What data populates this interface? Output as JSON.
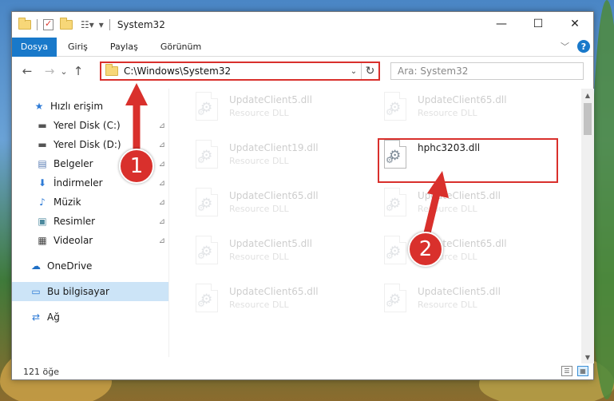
{
  "window": {
    "title": "System32",
    "qa_label": "|",
    "min": "—",
    "max": "☐",
    "close": "✕"
  },
  "ribbon": {
    "tabs": [
      "Dosya",
      "Giriş",
      "Paylaş",
      "Görünüm"
    ],
    "collapse_icon": "﹀",
    "help_label": "?"
  },
  "nav": {
    "back": "←",
    "forward": "→",
    "recent": "⌄",
    "up": "↑",
    "address": "C:\\Windows\\System32",
    "address_dropdown": "⌄",
    "refresh": "↻",
    "search_placeholder": "Ara: System32"
  },
  "sidebar": {
    "items": [
      {
        "label": "Hızlı erişim",
        "icon": "star-icon",
        "glyph": "★",
        "color": "#2e7bd6"
      },
      {
        "label": "Yerel Disk (C:)",
        "icon": "drive-icon",
        "glyph": "▬",
        "color": "#555555"
      },
      {
        "label": "Yerel Disk (D:)",
        "icon": "drive-icon",
        "glyph": "▬",
        "color": "#555555"
      },
      {
        "label": "Belgeler",
        "icon": "documents-icon",
        "glyph": "▤",
        "color": "#5d7fb5"
      },
      {
        "label": "İndirmeler",
        "icon": "download-icon",
        "glyph": "⬇",
        "color": "#2e7bd6"
      },
      {
        "label": "Müzik",
        "icon": "music-icon",
        "glyph": "♪",
        "color": "#2e7bd6"
      },
      {
        "label": "Resimler",
        "icon": "pictures-icon",
        "glyph": "▣",
        "color": "#4d8a9e"
      },
      {
        "label": "Videolar",
        "icon": "videos-icon",
        "glyph": "▦",
        "color": "#444444"
      },
      {
        "label": "OneDrive",
        "icon": "cloud-icon",
        "glyph": "☁",
        "color": "#1f6fc5"
      },
      {
        "label": "Bu bilgisayar",
        "icon": "computer-icon",
        "glyph": "▭",
        "color": "#2e7bd6"
      },
      {
        "label": "Ağ",
        "icon": "network-icon",
        "glyph": "⇄",
        "color": "#2e7bd6"
      }
    ],
    "pin_glyph": "📌"
  },
  "files": [
    {
      "name": "UpdateClient5.dll",
      "desc": "Resource DLL"
    },
    {
      "name": "UpdateClient65.dll",
      "desc": "Resource DLL"
    },
    {
      "name": "UpdateClient19.dll",
      "desc": "Resource DLL"
    },
    {
      "name": "hphc3203.dll",
      "desc": ""
    },
    {
      "name": "UpdateClient65.dll",
      "desc": "Resource DLL"
    },
    {
      "name": "UpdateClient5.dll",
      "desc": "Resource DLL"
    },
    {
      "name": "UpdateClient5.dll",
      "desc": "Resource DLL"
    },
    {
      "name": "UpdateClient65.dll",
      "desc": "Resource DLL"
    },
    {
      "name": "UpdateClient65.dll",
      "desc": "Resource DLL"
    },
    {
      "name": "UpdateClient5.dll",
      "desc": "Resource DLL"
    }
  ],
  "status": {
    "count": "121 öğe"
  },
  "annotations": {
    "step1": "1",
    "step2": "2",
    "color": "#d9302c"
  }
}
